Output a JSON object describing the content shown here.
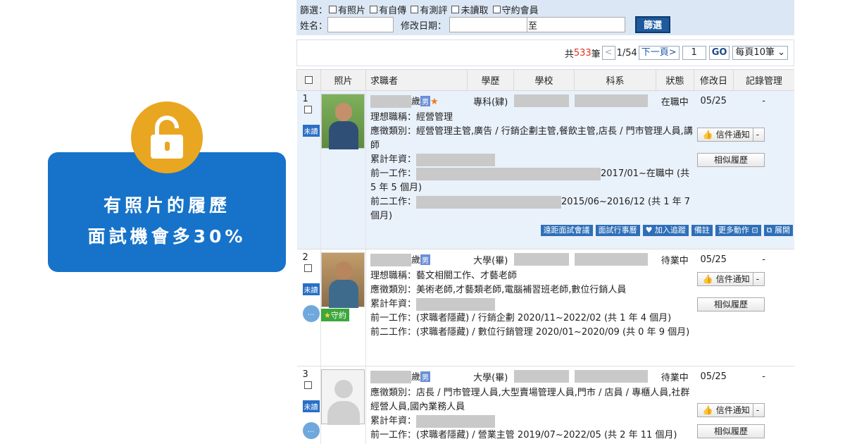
{
  "promo": {
    "line1": "有照片的履歷",
    "line2": "面試機會多30%"
  },
  "filter": {
    "label": "篩選：",
    "options": [
      "有照片",
      "有自傳",
      "有測評",
      "未讀取",
      "守約會員"
    ],
    "name_label": "姓名：",
    "date_label": "修改日期：",
    "to_label": "至",
    "button": "篩選"
  },
  "pager": {
    "total_prefix": "共",
    "total": "533",
    "total_suffix": "筆",
    "prev": "<",
    "pages": "1/54",
    "next": "下一頁>",
    "page_input": "1",
    "go": "GO",
    "per_page": "每頁10筆"
  },
  "columns": [
    "照片",
    "求職者",
    "學歷",
    "學校",
    "科系",
    "狀態",
    "修改日",
    "記錄管理"
  ],
  "rows": [
    {
      "num": "1",
      "unread": "未讀",
      "age_suffix": "歲",
      "gender": "男",
      "star": "★",
      "edu": "專科(肄)",
      "status": "在職中",
      "date": "05/25",
      "rec": "-",
      "ideal": "理想職稱：經營管理",
      "category": "應徵類別：經營管理主管,廣告 / 行銷企劃主管,餐飲主管,店長 / 門市管理人員,講師",
      "years_label": "累計年資：",
      "prev1_label": "前一工作：",
      "prev1_text": "2017/01~在職中 (共 5 年 5 個月)",
      "prev2_label": "前二工作：",
      "prev2_text": "2015/06~2016/12 (共 1 年 7 個月)",
      "notify": "信件通知",
      "similar": "相似履歷",
      "actions": [
        "遠距面試會議",
        "面試行事曆",
        "♥ 加入追蹤",
        "備註",
        "更多動作 ⊡",
        "⧉ 展開"
      ]
    },
    {
      "num": "2",
      "unread": "未讀",
      "age_suffix": "歲",
      "gender": "男",
      "contract": "守約",
      "edu": "大學(畢)",
      "status": "待業中",
      "date": "05/25",
      "rec": "-",
      "ideal": "理想職稱：藝文相關工作、才藝老師",
      "category": "應徵類別：美術老師,才藝類老師,電腦補習班老師,數位行銷人員",
      "years_label": "累計年資：",
      "prev1": "前一工作：(求職者隱藏) / 行銷企劃 2020/11~2022/02 (共 1 年 4 個月)",
      "prev2": "前二工作：(求職者隱藏) / 數位行銷管理 2020/01~2020/09 (共 0 年 9 個月)",
      "notify": "信件通知",
      "similar": "相似履歷"
    },
    {
      "num": "3",
      "unread": "未讀",
      "age_suffix": "歲",
      "gender": "男",
      "edu": "大學(畢)",
      "status": "待業中",
      "date": "05/25",
      "rec": "-",
      "category": "應徵類別：店長 / 門市管理人員,大型賣場管理人員,門市 / 店員 / 專櫃人員,社群經營人員,國內業務人員",
      "years_label": "累計年資：",
      "prev1": "前一工作：(求職者隱藏) / 營業主管 2019/07~2022/05 (共 2 年 11 個月)",
      "notify": "信件通知",
      "similar": "相似履歷"
    }
  ],
  "colors": {
    "accent": "#1673c9",
    "lock": "#e9a621",
    "filterbar": "#dbe7f4"
  }
}
